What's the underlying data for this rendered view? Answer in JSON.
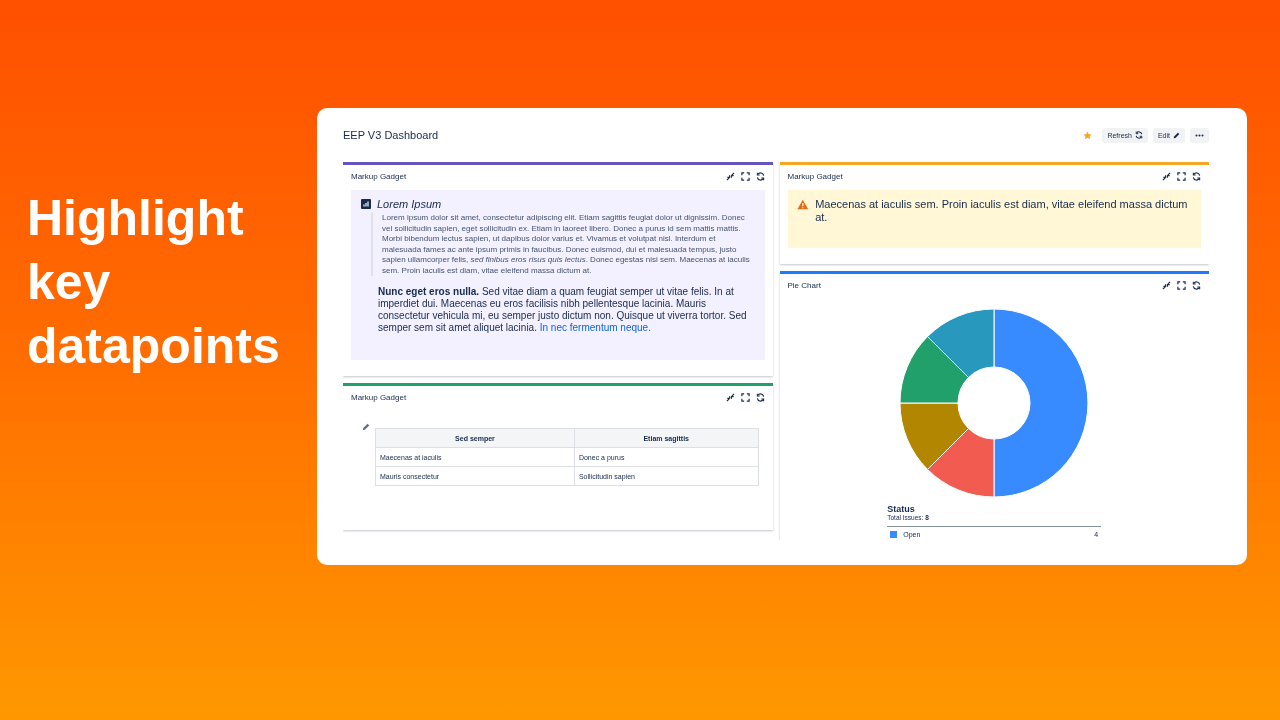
{
  "headline": "Highlight key datapoints",
  "dashboard": {
    "title": "EEP V3 Dashboard",
    "starred": true,
    "buttons": [
      {
        "kind": "refresh",
        "label": "Refresh"
      },
      {
        "kind": "edit",
        "label": "Edit"
      },
      {
        "kind": "more"
      }
    ],
    "columns": [
      [
        {
          "kind": "markup",
          "title": "Markup Gadget",
          "color": "#6554c0",
          "heading": "Lorem Ipsum",
          "quote": "Lorem ipsum dolor sit amet, consectetur adipiscing elit. Etiam sagittis feugiat dolor ut dignissim. Donec vel sollicitudin sapien, eget sollicitudin ex. Etiam in laoreet libero. Donec a purus id sem mattis mattis. Morbi bibendum lectus sapien, ut dapibus dolor varius et. Vivamus et volutpat nisl. Interdum et malesuada fames ac ante ipsum primis in faucibus. Donec euismod, dui et malesuada tempus, justo sapien ullamcorper felis, *sed finibus eros risus quis lectus*. Donec egestas nisi sem. Maecenas at iaculis sem. Proin iaculis est diam, vitae eleifend massa dictum at.",
          "paragraph": "**Nunc eget eros nulla.** Sed vitae diam a quam feugiat semper ut vitae felis. In at imperdiet dui. Maecenas eu eros facilisis nibh pellentesque lacinia. Mauris consectetur vehicula mi, eu semper justo dictum non. Quisque ut viverra tortor. Sed semper sem sit amet aliquet lacinia.",
          "link": "In nec fermentum neque."
        },
        {
          "kind": "table",
          "title": "Markup Gadget",
          "color": "#22a06b",
          "columns": [
            "Sed semper",
            "Etiam sagittis"
          ],
          "rows": [
            [
              "Maecenas at iaculis",
              "Donec a purus"
            ],
            [
              "Mauris consectetur",
              "Sollicitudin sapien"
            ]
          ]
        }
      ],
      [
        {
          "kind": "warning",
          "title": "Markup Gadget",
          "color": "#f5a623",
          "message": "Maecenas at iaculis sem. Proin iaculis est diam, vitae eleifend massa dictum at."
        },
        {
          "kind": "pie",
          "title": "Pie Chart",
          "color": "#1d7afc",
          "legend_title": "Status",
          "total": "Total Issues: **8**",
          "legend": [
            {
              "label": "Open",
              "count": "4",
              "color": "#388bff"
            }
          ]
        }
      ]
    ]
  }
}
